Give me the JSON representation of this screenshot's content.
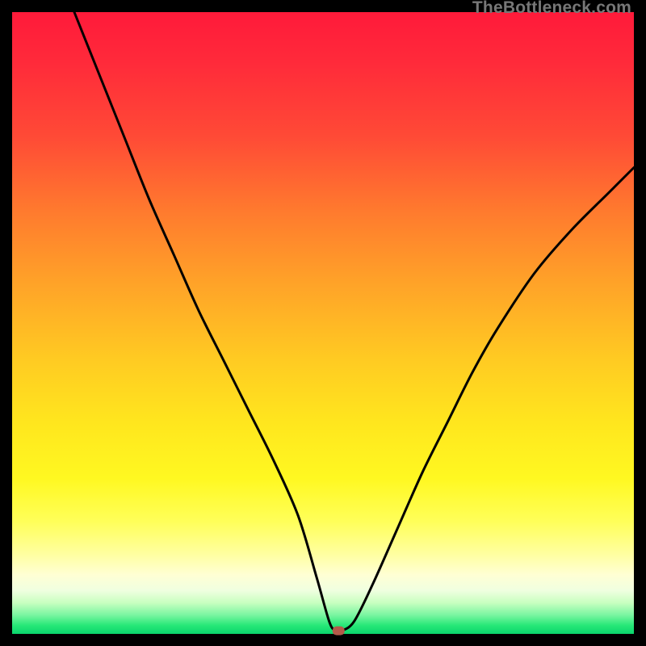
{
  "watermark": "TheBottleneck.com",
  "chart_data": {
    "type": "line",
    "title": "",
    "xlabel": "",
    "ylabel": "",
    "xlim": [
      0,
      100
    ],
    "ylim": [
      0,
      100
    ],
    "grid": false,
    "legend": false,
    "series": [
      {
        "name": "bottleneck-curve",
        "x": [
          10,
          14,
          18,
          22,
          26,
          30,
          34,
          38,
          42,
          46,
          49,
          51,
          52,
          53,
          55,
          58,
          62,
          66,
          70,
          74,
          78,
          84,
          90,
          96,
          100
        ],
        "values": [
          100,
          90,
          80,
          70,
          61,
          52,
          44,
          36,
          28,
          19,
          9,
          2,
          0.5,
          0.5,
          2,
          8,
          17,
          26,
          34,
          42,
          49,
          58,
          65,
          71,
          75
        ]
      }
    ],
    "marker": {
      "x": 52.5,
      "y": 0.5,
      "color": "#b35a4a"
    },
    "colors": {
      "curve": "#000000",
      "background_top": "#ff1a3a",
      "background_bottom": "#09d66c",
      "frame": "#000000"
    }
  }
}
